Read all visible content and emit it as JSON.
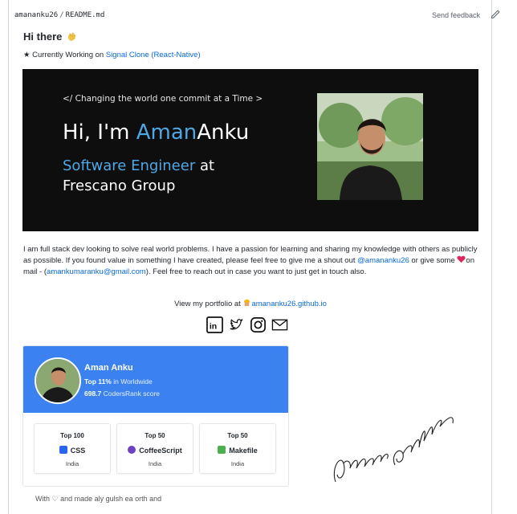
{
  "topbar": {
    "user": "amananku26",
    "separator": "/",
    "file": "README.md",
    "feedback": "Send feedback"
  },
  "heading": {
    "text": "Hi there"
  },
  "working": {
    "prefix": "★ Currently Working on",
    "link": "Signal Clone (React-Native)"
  },
  "banner": {
    "tagline": "</ Changing the world one commit at a Time >",
    "hi_prefix": "Hi, I'm ",
    "name_first": "Aman",
    "name_last": "Anku",
    "role": "Software Engineer",
    "at": " at",
    "company": "Frescano Group"
  },
  "about": {
    "text1": "I am full stack dev looking to solve real world problems. I have a passion for learning and sharing my knowledge with others as publicly as possible. If you found value in something I have created, please feel free to give me a shout out ",
    "handle": "@amananku26",
    "text2": " or give some ",
    "text3": "on mail - (",
    "email": "amankumaranku@gmail.com",
    "text4": "). Feel free to reach out in case you want to just get in touch also."
  },
  "portfolio": {
    "prefix": "View my portfolio at",
    "link": "amananku26.github.io"
  },
  "social": [
    "linkedin-icon",
    "twitter-icon",
    "instagram-icon",
    "mail-icon"
  ],
  "codersrank": {
    "name": "Aman Anku",
    "top_pct": "Top 11%",
    "scope": " in Worldwide",
    "score": "698.7",
    "score_label": " CodersRank score",
    "badges": [
      {
        "top": "Top 100",
        "lang": "CSS",
        "loc": "India",
        "color": "#2965f1"
      },
      {
        "top": "Top 50",
        "lang": "CoffeeScript",
        "loc": "India",
        "color": "#6f42c1"
      },
      {
        "top": "Top 50",
        "lang": "Makefile",
        "loc": "India",
        "color": "#4caf50"
      }
    ]
  },
  "cutoff": "With ♡ and made aly gulsh ea orth and"
}
